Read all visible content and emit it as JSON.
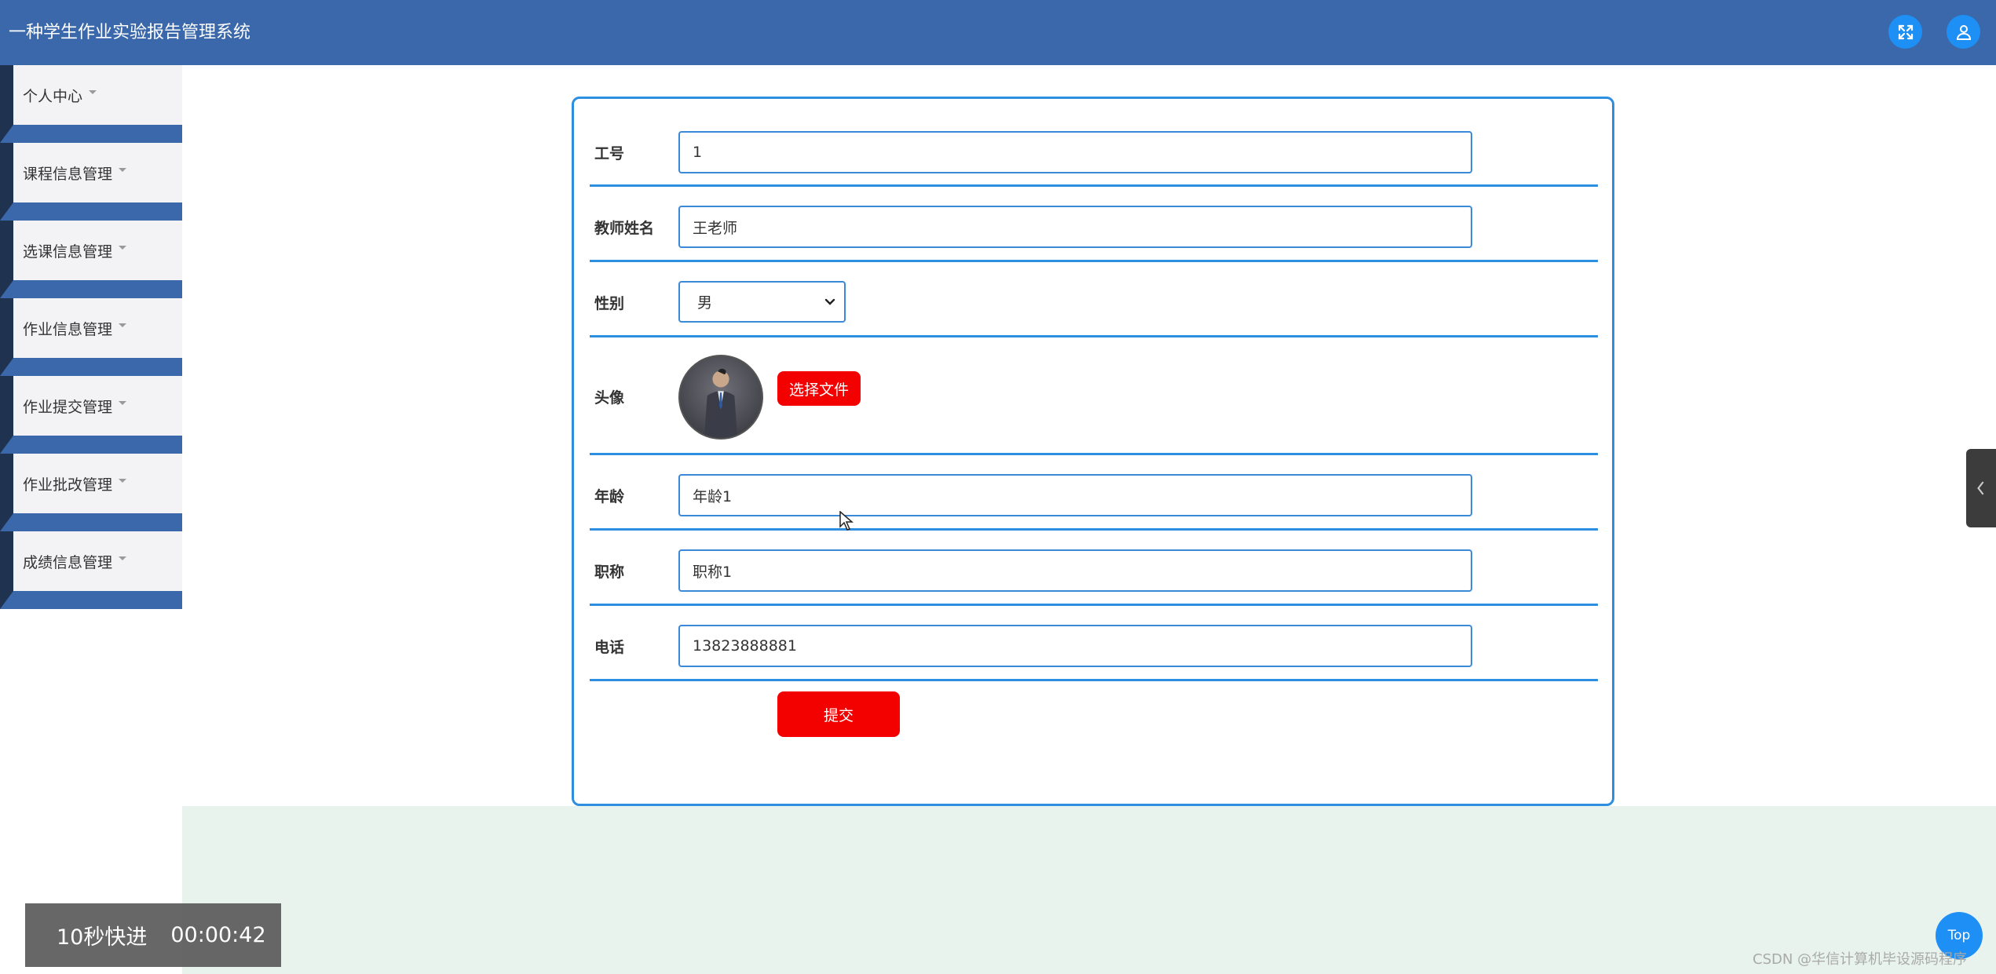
{
  "header": {
    "title": "一种学生作业实验报告管理系统",
    "fullscreen_icon": "expand-icon",
    "user_icon": "user-icon"
  },
  "sidebar": {
    "items": [
      {
        "label": "个人中心"
      },
      {
        "label": "课程信息管理"
      },
      {
        "label": "选课信息管理"
      },
      {
        "label": "作业信息管理"
      },
      {
        "label": "作业提交管理"
      },
      {
        "label": "作业批改管理"
      },
      {
        "label": "成绩信息管理"
      }
    ]
  },
  "form": {
    "employee_id": {
      "label": "工号",
      "value": "1"
    },
    "teacher_name": {
      "label": "教师姓名",
      "value": "王老师"
    },
    "gender": {
      "label": "性别",
      "value": "男"
    },
    "avatar": {
      "label": "头像",
      "choose_file": "选择文件"
    },
    "age": {
      "label": "年龄",
      "value": "年龄1"
    },
    "title": {
      "label": "职称",
      "value": "职称1"
    },
    "phone": {
      "label": "电话",
      "value": "13823888881"
    },
    "submit": "提交"
  },
  "overlay": {
    "skip_label": "10秒快进",
    "time": "00:00:42"
  },
  "top_button": "Top",
  "watermark": "CSDN @华信计算机毕设源码程序",
  "colors": {
    "header_bg": "#3a68aa",
    "accent_blue": "#2e8ee0",
    "button_red": "#f30000",
    "icon_blue": "#1e90f5",
    "bottom_fill": "#e8f3ed"
  }
}
